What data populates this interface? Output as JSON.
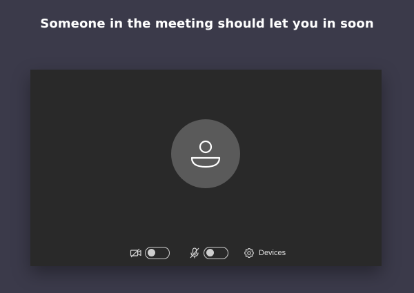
{
  "header": {
    "title": "Someone in the meeting should let you in soon"
  },
  "controls": {
    "camera_icon": "camera-off-icon",
    "camera_toggle_on": false,
    "mic_icon": "mic-off-icon",
    "mic_toggle_on": false,
    "devices_icon": "gear-icon",
    "devices_label": "Devices"
  },
  "colors": {
    "page_background": "#3b3a4a",
    "preview_background": "#292929",
    "avatar_background": "#5a5a5a",
    "foreground": "#ffffff"
  }
}
